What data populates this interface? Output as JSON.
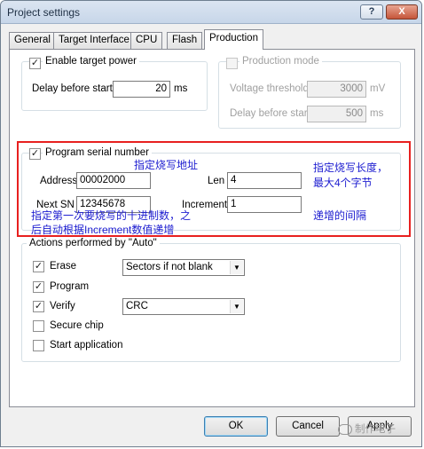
{
  "window": {
    "title": "Project settings",
    "help_glyph": "?",
    "close_glyph": "X"
  },
  "tabs": [
    {
      "label": "General"
    },
    {
      "label": "Target Interface"
    },
    {
      "label": "CPU"
    },
    {
      "label": "Flash"
    },
    {
      "label": "Production",
      "active": true
    }
  ],
  "power": {
    "enable_label": "Enable target power",
    "enable_checked": "✓",
    "delay_label": "Delay before start",
    "delay_value": "20",
    "delay_unit": "ms"
  },
  "production_mode": {
    "label": "Production mode",
    "voltage_label": "Voltage threshold",
    "voltage_value": "3000",
    "voltage_unit": "mV",
    "delay_label": "Delay before start",
    "delay_value": "500",
    "delay_unit": "ms"
  },
  "serial": {
    "label": "Program serial number",
    "checked": "✓",
    "address_label": "Address",
    "address_value": "00002000",
    "len_label": "Len",
    "len_value": "4",
    "next_sn_label": "Next SN",
    "next_sn_value": "12345678",
    "increment_label": "Increment",
    "increment_value": "1"
  },
  "annotations": {
    "address_note": "指定烧写地址",
    "len_note_1": "指定烧写长度，",
    "len_note_2": "最大4个字节",
    "sn_note_1": "指定第一次要烧写的十进制数，之",
    "sn_note_2": "后自动根据Increment数值递增",
    "increment_note": "递增的间隔"
  },
  "actions": {
    "label": "Actions performed by \"Auto\"",
    "items": [
      {
        "label": "Erase",
        "checked": "✓",
        "option": "Sectors if not blank"
      },
      {
        "label": "Program",
        "checked": "✓"
      },
      {
        "label": "Verify",
        "checked": "✓",
        "option": "CRC"
      },
      {
        "label": "Secure chip",
        "checked": ""
      },
      {
        "label": "Start application",
        "checked": ""
      }
    ],
    "dropdown_glyph": "▼"
  },
  "buttons": {
    "ok": "OK",
    "cancel": "Cancel",
    "apply": "Apply"
  },
  "watermark": {
    "text": "制作电子"
  }
}
